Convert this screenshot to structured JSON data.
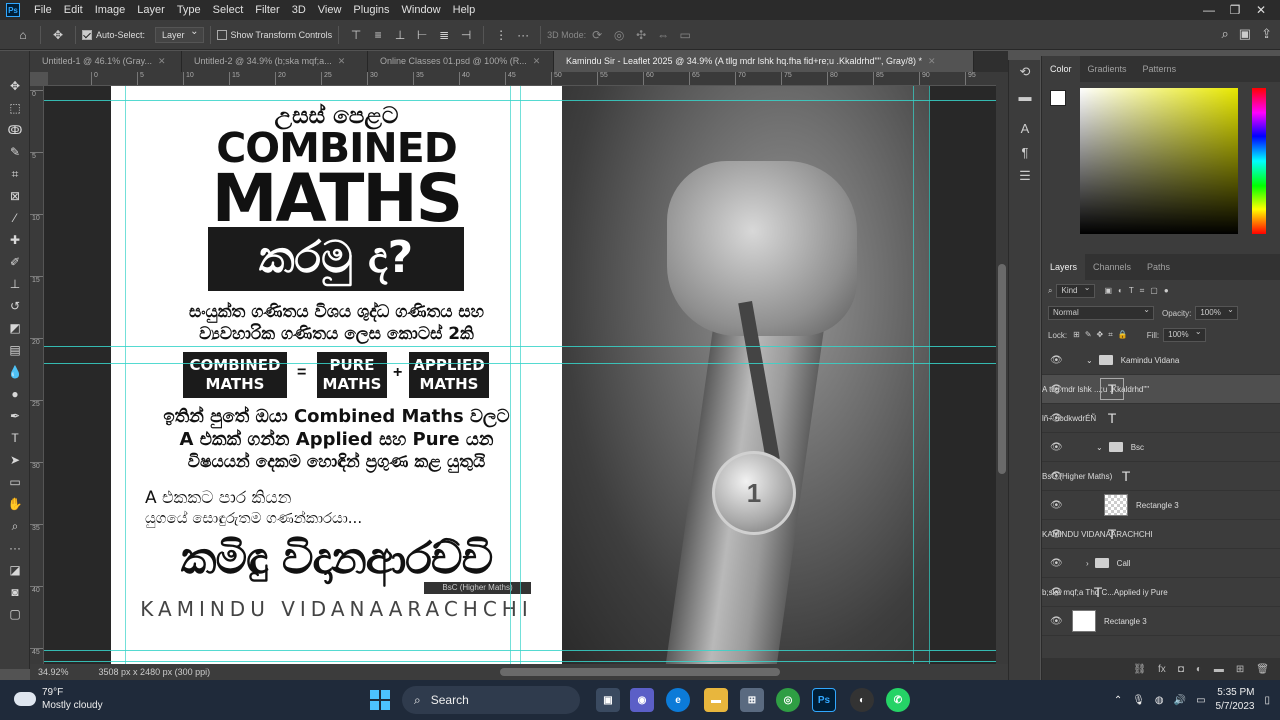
{
  "menu": [
    "File",
    "Edit",
    "Image",
    "Layer",
    "Type",
    "Select",
    "Filter",
    "3D",
    "View",
    "Plugins",
    "Window",
    "Help"
  ],
  "options": {
    "auto_select": "Auto-Select:",
    "layer_select": "Layer",
    "transform_controls": "Show Transform Controls",
    "mode_3d": "3D Mode:"
  },
  "tabs": [
    {
      "label": "Untitled-1 @ 46.1% (Gray...",
      "active": false
    },
    {
      "label": "Untitled-2 @ 34.9% (b;ska mqf;a...",
      "active": false
    },
    {
      "label": "Online Classes 01.psd @ 100% (R...",
      "active": false
    },
    {
      "label": "Kamindu Sir - Leaflet 2025 @ 34.9% (A tllg mdr lshk hq.fha fid+re;u .Kkaldrhd\"\", Gray/8) *",
      "active": true
    }
  ],
  "ruler_top": [
    "0",
    "5",
    "10",
    "15",
    "20",
    "25",
    "30",
    "35",
    "40",
    "45",
    "50",
    "55",
    "60",
    "65",
    "70",
    "75",
    "80",
    "85",
    "90",
    "95"
  ],
  "ruler_left": [
    "0",
    "5",
    "10",
    "15",
    "20",
    "25",
    "30",
    "35",
    "40",
    "45"
  ],
  "leaflet": {
    "heading_small": "උසස් පෙළට",
    "heading_combined": "COMBINED",
    "heading_maths": "MATHS",
    "heading_question": "කරමු ද?",
    "subtitle_line1": "සංයුක්ත ගණිතය විශය ශුද්ධ ගණිතය සහ",
    "subtitle_line2": "ව්‍යවහාරික ගණිතය ලෙස කොටස් 2කි",
    "eq_combined_1": "COMBINED",
    "eq_combined_2": "MATHS",
    "eq_equals": "=",
    "eq_pure_1": "PURE",
    "eq_pure_2": "MATHS",
    "eq_plus": "+",
    "eq_applied_1": "APPLIED",
    "eq_applied_2": "MATHS",
    "body_line1": "ඉතින් පුතේ ඔයා Combined Maths වලට",
    "body_line2": "A එකක් ගන්න Applied සහ Pure යන",
    "body_line3": "විෂයයන් දෙකම හොඳින් ප්‍රගුණ කළ යුතුයි",
    "tag_line1": "A එකකට පාර කියන",
    "tag_line2": "යුගයේ සොඳුරුතම ගණන්කාරයා...",
    "name_sinhala": "කමිඳු විදානආරච්චි",
    "degree": "BsC (Higher Maths)",
    "name_english": "KAMINDU VIDANAARACHCHI",
    "medal_number": "1"
  },
  "status": {
    "zoom": "34.92%",
    "doc_size": "3508 px x 2480 px (300 ppi)"
  },
  "color_panel": {
    "tabs": [
      "Color",
      "Gradients",
      "Patterns"
    ]
  },
  "layers_panel": {
    "tabs": [
      "Layers",
      "Channels",
      "Paths"
    ],
    "kind": "Kind",
    "blend": "Normal",
    "opacity_label": "Opacity:",
    "opacity": "100%",
    "lock_label": "Lock:",
    "fill_label": "Fill:",
    "fill": "100%",
    "items": [
      {
        "name": "Kamindu Vidana",
        "type": "group"
      },
      {
        "name": "A tllg mdr lshk ...;u .Kkaldrhd\"\"",
        "type": "text",
        "selected": true
      },
      {
        "name": "lñ÷ úodkwdrÉÑ",
        "type": "text"
      },
      {
        "name": "Bsc",
        "type": "group"
      },
      {
        "name": "BsC (Higher Maths)",
        "type": "text"
      },
      {
        "name": "Rectangle 3",
        "type": "shape"
      },
      {
        "name": "KAMINDU VIDANAARACHCHI",
        "type": "text"
      },
      {
        "name": "Call",
        "type": "group"
      },
      {
        "name": "b;ska mqf;a Thd C...Applied iy Pure",
        "type": "text"
      },
      {
        "name": "Rectangle 3",
        "type": "shape"
      }
    ]
  },
  "taskbar": {
    "temp": "79°F",
    "weather": "Mostly cloudy",
    "search": "Search",
    "time": "5:35 PM",
    "date": "5/7/2023"
  }
}
